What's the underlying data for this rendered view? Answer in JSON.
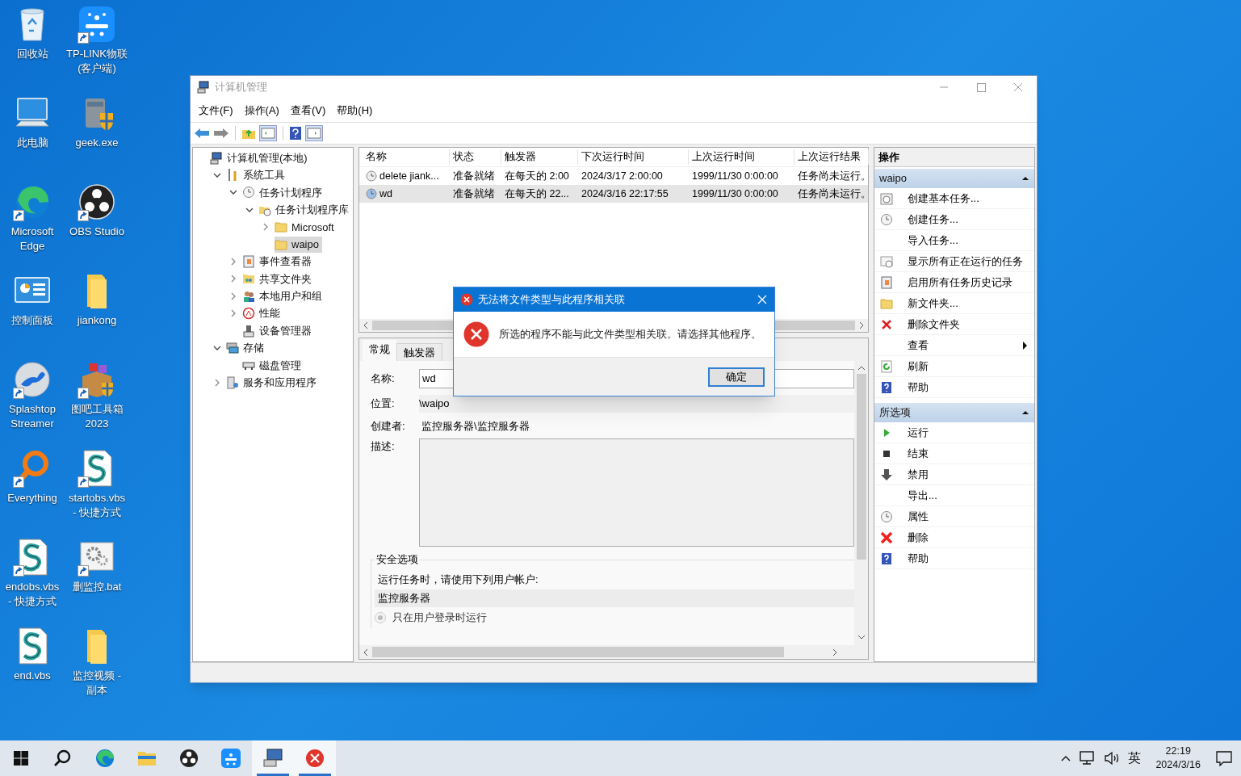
{
  "desktop_icons": [
    {
      "lines": [
        "回收站"
      ],
      "kind": "recycle",
      "shortcut": false
    },
    {
      "lines": [
        "TP-LINK物联",
        "(客户端)"
      ],
      "kind": "tplink",
      "shortcut": true
    },
    {
      "lines": [
        "此电脑"
      ],
      "kind": "pc",
      "shortcut": false
    },
    {
      "lines": [
        "geek.exe"
      ],
      "kind": "geek",
      "shortcut": false
    },
    {
      "lines": [
        "Microsoft",
        "Edge"
      ],
      "kind": "edge",
      "shortcut": true
    },
    {
      "lines": [
        "OBS Studio"
      ],
      "kind": "obs",
      "shortcut": true
    },
    {
      "lines": [
        "控制面板"
      ],
      "kind": "control",
      "shortcut": false
    },
    {
      "lines": [
        "jiankong"
      ],
      "kind": "folder",
      "shortcut": false
    },
    {
      "lines": [
        "Splashtop",
        "Streamer"
      ],
      "kind": "splashtop",
      "shortcut": true
    },
    {
      "lines": [
        "图吧工具箱",
        "2023"
      ],
      "kind": "toolbox",
      "shortcut": true
    },
    {
      "lines": [
        "Everything"
      ],
      "kind": "everything",
      "shortcut": true
    },
    {
      "lines": [
        "startobs.vbs",
        "- 快捷方式"
      ],
      "kind": "script",
      "shortcut": true
    },
    {
      "lines": [
        "endobs.vbs",
        "- 快捷方式"
      ],
      "kind": "script",
      "shortcut": true
    },
    {
      "lines": [
        "删监控.bat"
      ],
      "kind": "gears",
      "shortcut": true
    },
    {
      "lines": [
        "end.vbs"
      ],
      "kind": "script",
      "shortcut": false
    },
    {
      "lines": [
        "监控视频 -",
        "副本"
      ],
      "kind": "folder",
      "shortcut": false
    }
  ],
  "window": {
    "title": "计算机管理",
    "menu": [
      "文件(F)",
      "操作(A)",
      "查看(V)",
      "帮助(H)"
    ],
    "tree": [
      {
        "label": "计算机管理(本地)",
        "kind": "computer",
        "selected": false,
        "children": [
          {
            "label": "系统工具",
            "kind": "tools",
            "expanded": true,
            "selected": false,
            "children": [
              {
                "label": "任务计划程序",
                "kind": "clock",
                "expanded": true,
                "selected": false,
                "children": [
                  {
                    "label": "任务计划程序库",
                    "kind": "clockfolder",
                    "expanded": true,
                    "selected": false,
                    "children": [
                      {
                        "label": "Microsoft",
                        "kind": "folder",
                        "expanded": false,
                        "selected": false
                      },
                      {
                        "label": "waipo",
                        "kind": "folder",
                        "selected": true
                      }
                    ]
                  }
                ]
              },
              {
                "label": "事件查看器",
                "kind": "event",
                "expanded": false,
                "selected": false
              },
              {
                "label": "共享文件夹",
                "kind": "share",
                "expanded": false,
                "selected": false
              },
              {
                "label": "本地用户和组",
                "kind": "users",
                "expanded": false,
                "selected": false
              },
              {
                "label": "性能",
                "kind": "perf",
                "expanded": false,
                "selected": false
              },
              {
                "label": "设备管理器",
                "kind": "device",
                "selected": false
              }
            ]
          },
          {
            "label": "存储",
            "kind": "storage",
            "expanded": true,
            "selected": false,
            "children": [
              {
                "label": "磁盘管理",
                "kind": "disk",
                "selected": false
              }
            ]
          },
          {
            "label": "服务和应用程序",
            "kind": "services",
            "expanded": false,
            "selected": false
          }
        ]
      }
    ],
    "table": {
      "columns": [
        "名称",
        "状态",
        "触发器",
        "下次运行时间",
        "上次运行时间",
        "上次运行结果"
      ],
      "rows": [
        {
          "selected": false,
          "cells": [
            "delete jiank...",
            "准备就绪",
            "在每天的 2:00",
            "2024/3/17 2:00:00",
            "1999/11/30 0:00:00",
            "任务尚未运行。"
          ]
        },
        {
          "selected": true,
          "cells": [
            "wd",
            "准备就绪",
            "在每天的 22...",
            "2024/3/16 22:17:55",
            "1999/11/30 0:00:00",
            "任务尚未运行。"
          ]
        }
      ]
    },
    "details": {
      "tabs": [
        {
          "label": "常规",
          "selected": true
        },
        {
          "label": "触发器",
          "selected": false
        }
      ],
      "name_label": "名称:",
      "name_value": "wd",
      "location_label": "位置:",
      "location_value": "\\waipo",
      "author_label": "创建者:",
      "author_value": "监控服务器\\监控服务器",
      "description_label": "描述:",
      "security_title": "安全选项",
      "security_text": "运行任务时，请使用下列用户帐户:",
      "account": "监控服务器",
      "radios": [
        {
          "label": "只在用户登录时运行",
          "selected": true,
          "disabled": true
        }
      ]
    },
    "actions": {
      "title": "操作",
      "sections": [
        {
          "title": "waipo",
          "expanded": true,
          "items": [
            {
              "label": "创建基本任务...",
              "kind": "basictask"
            },
            {
              "label": "创建任务...",
              "kind": "task"
            },
            {
              "label": "导入任务...",
              "kind": "plain"
            },
            {
              "label": "显示所有正在运行的任务",
              "kind": "running"
            },
            {
              "label": "启用所有任务历史记录",
              "kind": "history"
            },
            {
              "label": "新文件夹...",
              "kind": "newfolder"
            },
            {
              "label": "删除文件夹",
              "kind": "xsmall"
            },
            {
              "label": "查看",
              "kind": "submenu"
            },
            {
              "label": "刷新",
              "kind": "refresh"
            },
            {
              "label": "帮助",
              "kind": "help"
            }
          ]
        },
        {
          "title": "所选项",
          "expanded": true,
          "items": [
            {
              "label": "运行",
              "kind": "run"
            },
            {
              "label": "结束",
              "kind": "stop"
            },
            {
              "label": "禁用",
              "kind": "disable"
            },
            {
              "label": "导出...",
              "kind": "plain"
            },
            {
              "label": "属性",
              "kind": "props"
            },
            {
              "label": "删除",
              "kind": "xbig"
            },
            {
              "label": "帮助",
              "kind": "help"
            }
          ]
        }
      ]
    }
  },
  "dialog": {
    "title": "无法将文件类型与此程序相关联",
    "message": "所选的程序不能与此文件类型相关联。请选择其他程序。",
    "button": "确定"
  },
  "taskbar": {
    "apps": [
      {
        "kind": "search",
        "active": false
      },
      {
        "kind": "edge",
        "active": false
      },
      {
        "kind": "explorer",
        "active": false
      },
      {
        "kind": "obs",
        "active": false
      },
      {
        "kind": "tplink",
        "active": false
      },
      {
        "kind": "compmgmt",
        "active": true
      },
      {
        "kind": "error",
        "active": true
      }
    ],
    "ime": "英",
    "time": "22:19",
    "date": "2024/3/16"
  }
}
